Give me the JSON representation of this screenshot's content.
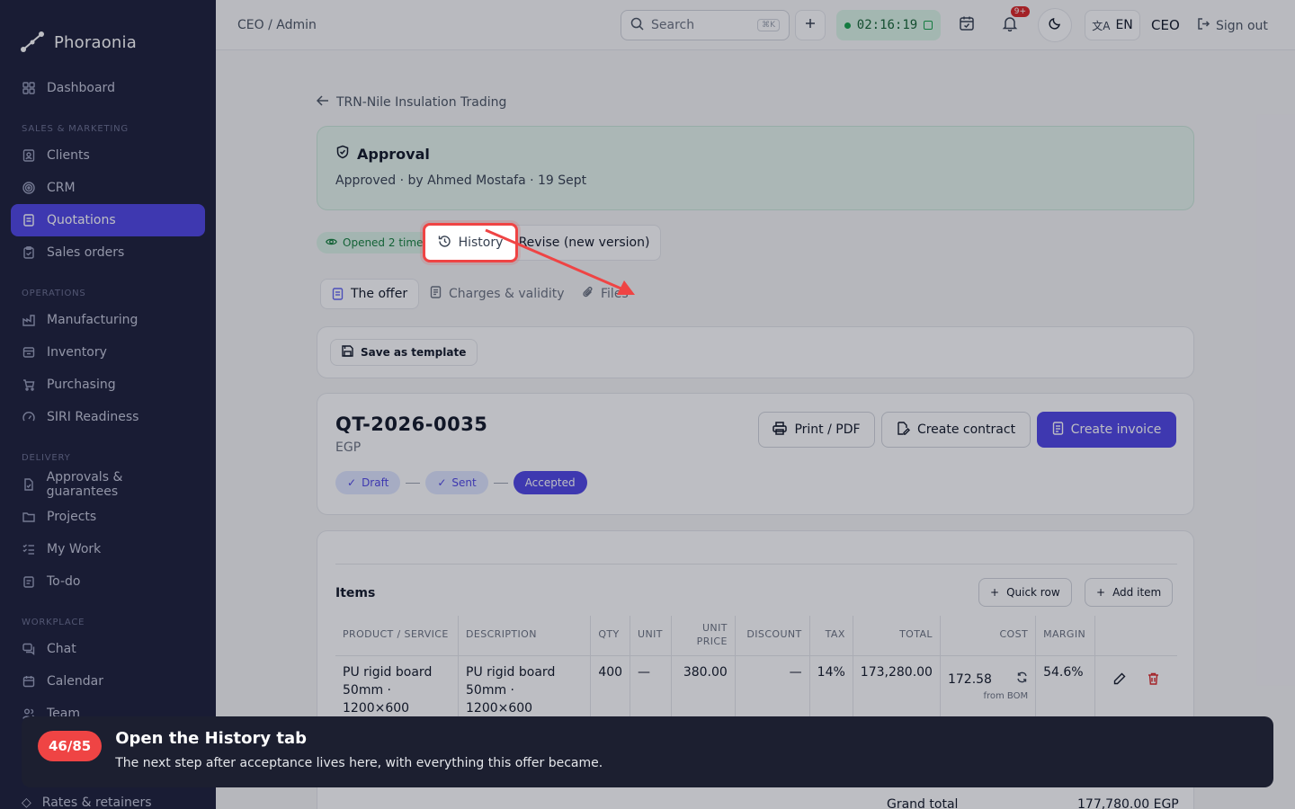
{
  "app": {
    "name": "Phoraonia"
  },
  "sidebar": {
    "items": [
      {
        "label": "Dashboard",
        "icon": "grid-icon"
      },
      {
        "section": "SALES & MARKETING"
      },
      {
        "label": "Clients",
        "icon": "id-card-icon"
      },
      {
        "label": "CRM",
        "icon": "target-icon"
      },
      {
        "label": "Quotations",
        "icon": "document-icon",
        "active": true
      },
      {
        "label": "Sales orders",
        "icon": "clipboard-icon"
      },
      {
        "section": "OPERATIONS"
      },
      {
        "label": "Manufacturing",
        "icon": "factory-icon"
      },
      {
        "label": "Inventory",
        "icon": "box-icon"
      },
      {
        "label": "Purchasing",
        "icon": "cart-icon"
      },
      {
        "label": "SIRI Readiness",
        "icon": "gauge-icon"
      },
      {
        "section": "DELIVERY"
      },
      {
        "label": "Approvals & guarantees",
        "icon": "file-check-icon"
      },
      {
        "label": "Projects",
        "icon": "folder-icon"
      },
      {
        "label": "My Work",
        "icon": "checklist-icon"
      },
      {
        "label": "To-do",
        "icon": "todo-icon"
      },
      {
        "section": "WORKPLACE"
      },
      {
        "label": "Chat",
        "icon": "chat-icon"
      },
      {
        "label": "Calendar",
        "icon": "calendar-icon"
      },
      {
        "label": "Team",
        "icon": "users-icon"
      }
    ],
    "hidden_item": "Rates & retainers"
  },
  "topbar": {
    "breadcrumb": "CEO / Admin",
    "search_placeholder": "Search",
    "search_shortcut": "⌘K",
    "timer": "02:16:19",
    "notif_badge": "9+",
    "lang": "EN",
    "role": "CEO",
    "signout": "Sign out"
  },
  "page": {
    "back_label": "TRN-Nile Insulation Trading",
    "approval": {
      "title": "Approval",
      "subtitle": "Approved · by Ahmed Mostafa · 19 Sept"
    },
    "opened_badge": "Opened 2 times · 19 Sept",
    "revise_label": "Revise (new version)",
    "tabs": {
      "offer": "The offer",
      "charges": "Charges & validity",
      "files": "Files",
      "history": "History"
    },
    "save_template": "Save as template",
    "quote": {
      "number": "QT-2026-0035",
      "currency": "EGP",
      "statuses": {
        "draft": "Draft",
        "sent": "Sent",
        "accepted": "Accepted"
      },
      "print": "Print / PDF",
      "contract": "Create contract",
      "invoice": "Create invoice"
    },
    "items": {
      "title": "Items",
      "quick_row": "Quick row",
      "add_item": "Add item",
      "columns": {
        "product": "PRODUCT / SERVICE",
        "description": "DESCRIPTION",
        "qty": "QTY",
        "unit": "UNIT",
        "unit_price": "UNIT PRICE",
        "discount": "DISCOUNT",
        "tax": "TAX",
        "total": "TOTAL",
        "cost": "COST",
        "margin": "MARGIN"
      },
      "rows": [
        {
          "product": "PU rigid board 50mm · 1200×600",
          "description": "PU rigid board 50mm · 1200×600",
          "qty": "400",
          "unit": "—",
          "unit_price": "380.00",
          "discount": "—",
          "tax": "14%",
          "total": "173,280.00",
          "cost": "172.58",
          "cost_note": "from BOM",
          "margin": "54.6%"
        }
      ]
    },
    "grand_total_label": "Grand total",
    "grand_total_value": "177,780.00 EGP"
  },
  "tour": {
    "step": "46/85",
    "title": "Open the History tab",
    "description": "The next step after acceptance lives here, with everything this offer became."
  },
  "colors": {
    "accent": "#4f46e5",
    "sidebar": "#1c1f3a",
    "highlight": "#ef4444",
    "success": "#15803d"
  }
}
